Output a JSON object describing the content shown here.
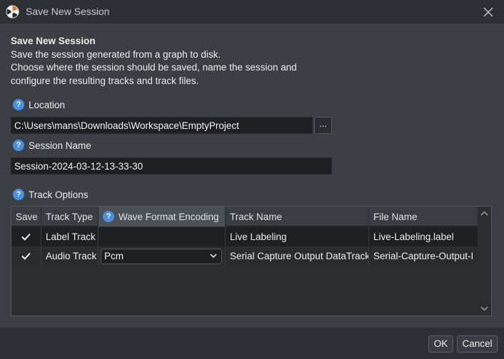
{
  "window": {
    "title": "Save New Session"
  },
  "intro": {
    "heading": "Save New Session",
    "line1": "Save the session generated from a graph to disk.",
    "line2": "Choose where the session should be saved, name the session and",
    "line3": "configure the resulting tracks and track files."
  },
  "location": {
    "label": "Location",
    "value": "C:\\Users\\mans\\Downloads\\Workspace\\EmptyProject",
    "browse_label": "..."
  },
  "session_name": {
    "label": "Session Name",
    "value": "Session-2024-03-12-13-33-30"
  },
  "track_options": {
    "label": "Track Options",
    "columns": {
      "save": "Save",
      "track_type": "Track Type",
      "wave_format": "Wave Format Encoding",
      "track_name": "Track Name",
      "file_name": "File Name"
    },
    "rows": [
      {
        "save": true,
        "track_type": "Label Track",
        "wave_format": "",
        "track_name": "Live Labeling",
        "file_name": "Live-Labeling.label"
      },
      {
        "save": true,
        "track_type": "Audio Track",
        "wave_format": "Pcm",
        "track_name": "Serial Capture Output DataTrack",
        "file_name": "Serial-Capture-Output-I"
      }
    ]
  },
  "buttons": {
    "ok": "OK",
    "cancel": "Cancel"
  },
  "icons": {
    "app": "app-logo-icon",
    "close": "close-icon",
    "help": "help-icon",
    "check": "checkmark-icon",
    "dropdown": "chevron-down-icon",
    "scroll_up": "chevron-up-icon",
    "scroll_down": "chevron-down-icon"
  },
  "colors": {
    "background": "#3c3f44",
    "titlebar": "#2d3035",
    "input": "#1f2023",
    "accent": "#4a90e2"
  }
}
